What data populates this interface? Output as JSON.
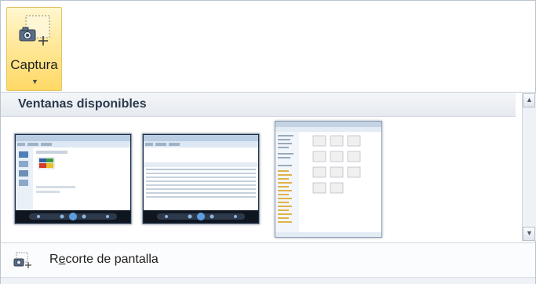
{
  "capture": {
    "label": "Captura",
    "icon": "screenshot-camera-icon"
  },
  "gallery": {
    "title": "Ventanas disponibles",
    "windows": [
      {
        "name": "window-thumbnail-1",
        "icon": "window-preview"
      },
      {
        "name": "window-thumbnail-2",
        "icon": "window-preview"
      },
      {
        "name": "window-thumbnail-3",
        "icon": "window-preview"
      }
    ]
  },
  "clip": {
    "label_prefix": "R",
    "label_mnemonic": "e",
    "label_rest": "corte de pantalla",
    "icon": "screen-clipping-icon"
  },
  "scroll": {
    "up_icon": "triangle-up-icon",
    "down_icon": "triangle-down-icon"
  },
  "colors": {
    "accent": "#ffd966",
    "header_text": "#2b3a4d",
    "border": "#b9c3cf"
  }
}
